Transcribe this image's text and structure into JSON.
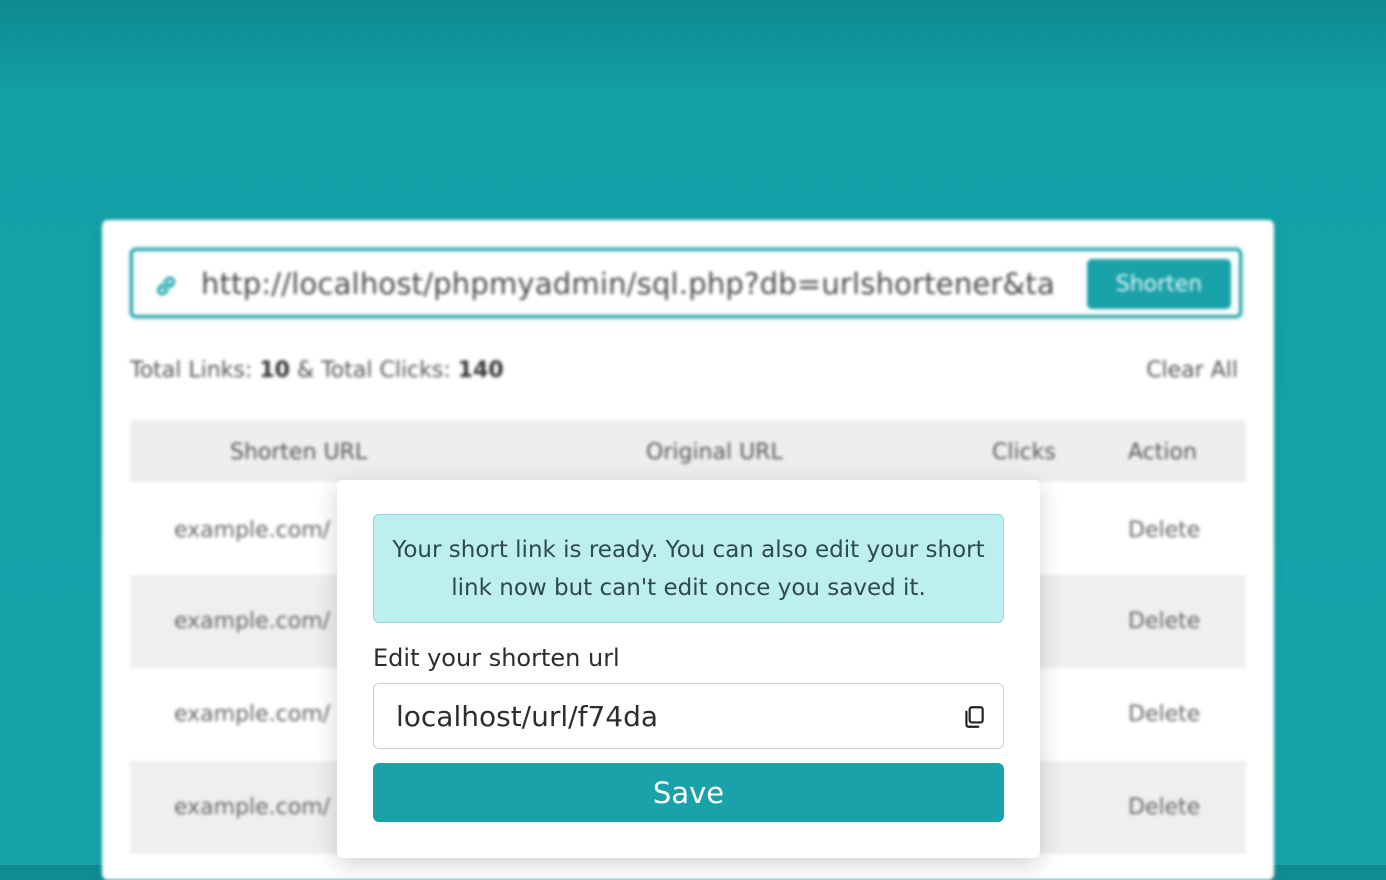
{
  "colors": {
    "accent": "#19a2a9",
    "background": "#16a4ab",
    "notice_bg": "#bdeef0"
  },
  "app": {
    "url_input_value": "http://localhost/phpmyadmin/sql.php?db=urlshortener&ta",
    "shorten_label": "Shorten",
    "stats": {
      "links_label": "Total Links:",
      "links_value": "10",
      "separator": "&",
      "clicks_label": "Total Clicks:",
      "clicks_value": "140"
    },
    "clear_all_label": "Clear All",
    "table": {
      "headers": [
        "Shorten URL",
        "Original URL",
        "Clicks",
        "Action"
      ],
      "rows": [
        {
          "short": "example.com/",
          "action": "Delete"
        },
        {
          "short": "example.com/",
          "action": "Delete"
        },
        {
          "short": "example.com/",
          "action": "Delete"
        },
        {
          "short": "example.com/",
          "action": "Delete"
        }
      ]
    }
  },
  "modal": {
    "notice": "Your short link is ready. You can also edit your short link now but can't edit once you saved it.",
    "field_label": "Edit your shorten url",
    "field_value": "localhost/url/f74da",
    "copy_icon": "copy-icon",
    "save_label": "Save"
  }
}
